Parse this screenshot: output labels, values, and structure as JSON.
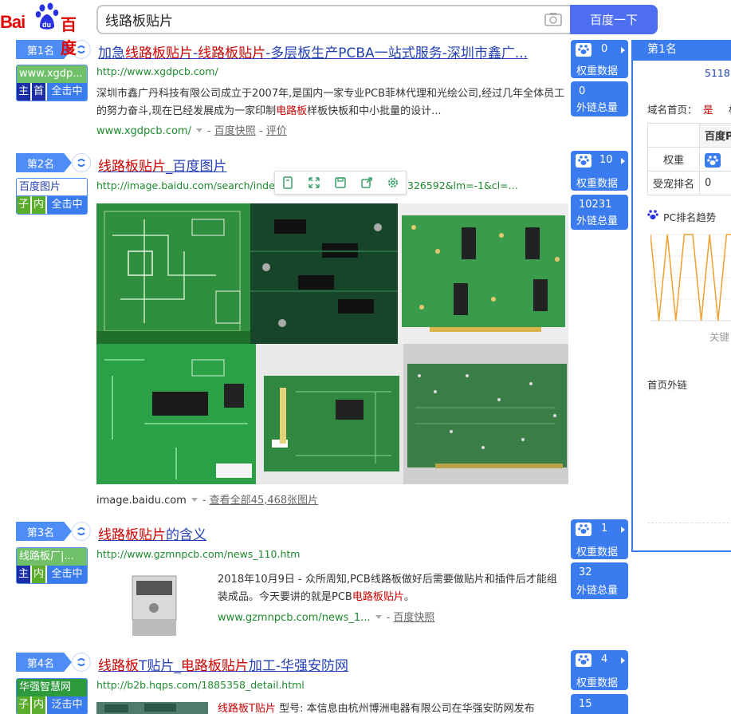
{
  "search": {
    "query": "线路板贴片",
    "button": "百度一下"
  },
  "logo": {
    "bai": "Bai",
    "du": "du",
    "chinese": "百度"
  },
  "stats_labels": {
    "weight": "权重数据",
    "links": "外链总量"
  },
  "results": [
    {
      "rank": "第1名",
      "site": "www.xgdp...",
      "flags": [
        "主",
        "首",
        "全击中"
      ],
      "title_parts": [
        "加急",
        "线路板贴片",
        "-",
        "线路板贴片",
        "-多层板生产PCBA一站式服务-深圳市鑫广..."
      ],
      "url": "http://www.xgdpcb.com/",
      "desc_parts": [
        "深圳市鑫广丹科技有限公司成立于2007年,是国内一家专业PCB菲林代理和光绘公司,经过几年全体员工的努力奋斗,现在已经发展成为一家印制",
        "电路板",
        "样板快板和中小批量的设计..."
      ],
      "meta_url": "www.xgdpcb.com/",
      "meta_links": [
        "百度快照",
        "评价"
      ],
      "weight": "0",
      "links": "0"
    },
    {
      "rank": "第2名",
      "site": "百度图片",
      "flags": [
        "子",
        "内",
        "全击中"
      ],
      "title_parts": [
        "线路板贴片",
        "_百度图片"
      ],
      "url_left": "http://image.baidu.com/search/inde",
      "url_right": "326592&lm=-1&cl=...",
      "meta_url": "image.baidu.com",
      "meta_links": [
        "查看全部45,468张图片"
      ],
      "weight": "10",
      "links": "10231"
    },
    {
      "rank": "第3名",
      "site": "线路板厂|...",
      "flags": [
        "主",
        "内",
        "全击中"
      ],
      "title_parts": [
        "线路板贴片",
        "的含义"
      ],
      "url": "http://www.gzmnpcb.com/news_110.htm",
      "desc_parts": [
        "2018年10月9日 - 众所周知,PCB线路板做好后需要做贴片和插件后才能组装成品。今天要讲的就是PCB",
        "电路板贴片",
        "。"
      ],
      "meta_url": "www.gzmnpcb.com/news_1...",
      "meta_links": [
        "百度快照"
      ],
      "weight": "1",
      "links": "32"
    },
    {
      "rank": "第4名",
      "site": "华强智慧网",
      "flags": [
        "子",
        "内",
        "泛击中"
      ],
      "title_parts": [
        "线路板",
        "T贴片",
        "_",
        "电路板贴片",
        "加工-华强安防网"
      ],
      "url": "http://b2b.hqps.com/1885358_detail.html",
      "desc_parts": [
        "线路板T贴片",
        " 型号: 本信息由杭州博洲电器有限公司在华强安防网发布"
      ],
      "weight": "4",
      "links": "15"
    }
  ],
  "panel": {
    "head": "第1名",
    "num": "5118",
    "domain_label": "域名首页：",
    "domain_value": "是",
    "domain_extra": "权",
    "table_header": "百度PC",
    "row1_label": "权重",
    "row2_label": "受宠排名",
    "row2_value": "0",
    "trend_title": "PC排名趋势",
    "trend_axis": "关键",
    "links_title": "首页外链",
    "trend": [
      1,
      0,
      1,
      0,
      1,
      1,
      0,
      1,
      0,
      1,
      1
    ]
  },
  "colors": {
    "accent": "#4e6ef2",
    "badge": "#3a7bf0",
    "link": "#2440b3",
    "url": "#1e8a2e",
    "highlight": "#cc0000"
  }
}
